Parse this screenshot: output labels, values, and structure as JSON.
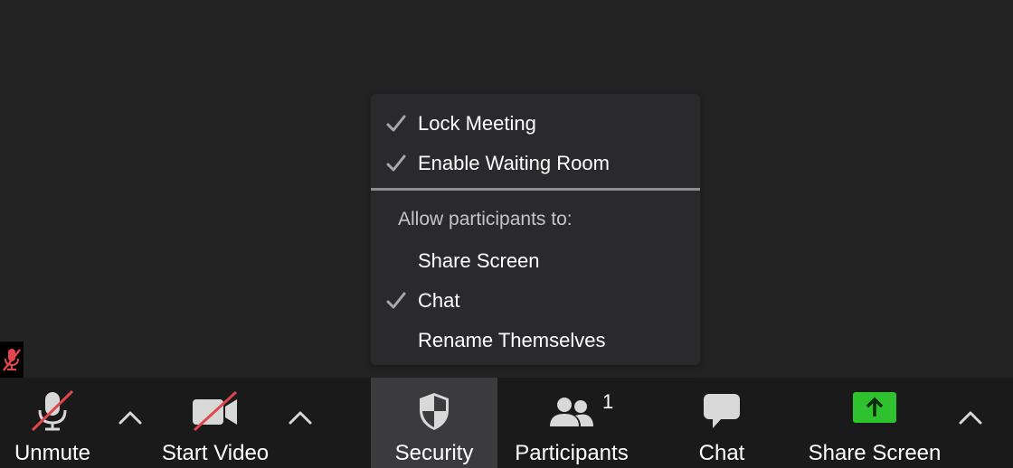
{
  "security_menu": {
    "items": [
      {
        "label": "Lock Meeting",
        "checked": true
      },
      {
        "label": "Enable Waiting Room",
        "checked": true
      }
    ],
    "allow_heading": "Allow participants to:",
    "allow_items": [
      {
        "label": "Share Screen",
        "checked": false
      },
      {
        "label": "Chat",
        "checked": true
      },
      {
        "label": "Rename Themselves",
        "checked": false
      }
    ]
  },
  "toolbar": {
    "unmute_label": "Unmute",
    "start_video_label": "Start Video",
    "security_label": "Security",
    "participants_label": "Participants",
    "participants_count": "1",
    "chat_label": "Chat",
    "share_screen_label": "Share Screen"
  },
  "icons": {
    "mic": "mic-muted-icon",
    "video": "video-off-icon",
    "security": "shield-icon",
    "participants": "people-icon",
    "chat": "chat-bubble-icon",
    "share": "share-screen-icon",
    "caret": "chevron-up-icon",
    "check": "check-icon"
  },
  "colors": {
    "background": "#232323",
    "toolbar": "#1a1a1a",
    "menu": "#2a2a2c",
    "active_button": "#3b3b3d",
    "mute_slash": "#e0464a",
    "share_green": "#2fc22f",
    "checkmark": "#a8a8aa"
  }
}
